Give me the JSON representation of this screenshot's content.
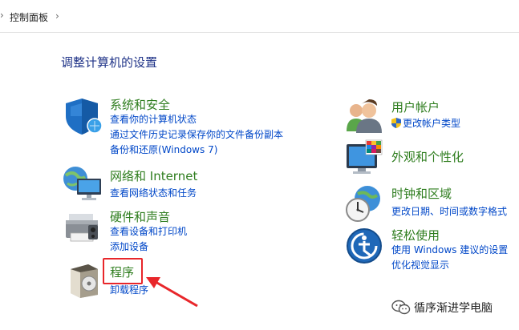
{
  "breadcrumb": {
    "label": "控制面板"
  },
  "page_title": "调整计算机的设置",
  "left_categories": [
    {
      "title": "系统和安全",
      "links": [
        "查看你的计算机状态",
        "通过文件历史记录保存你的文件备份副本",
        "备份和还原(Windows 7)"
      ]
    },
    {
      "title": "网络和 Internet",
      "links": [
        "查看网络状态和任务"
      ]
    },
    {
      "title": "硬件和声音",
      "links": [
        "查看设备和打印机",
        "添加设备"
      ]
    },
    {
      "title": "程序",
      "links": [
        "卸载程序"
      ]
    }
  ],
  "right_categories": [
    {
      "title": "用户帐户",
      "links": [
        "更改帐户类型"
      ]
    },
    {
      "title": "外观和个性化",
      "links": []
    },
    {
      "title": "时钟和区域",
      "links": [
        "更改日期、时间或数字格式"
      ]
    },
    {
      "title": "轻松使用",
      "links": [
        "使用 Windows 建议的设置",
        "优化视觉显示"
      ]
    }
  ],
  "watermark": {
    "text": "循序渐进学电脑"
  },
  "colors": {
    "title_green": "#2e7d1e",
    "link_blue": "#0047c8",
    "heading_blue": "#1e3287",
    "highlight_red": "#e8262a"
  },
  "icons": [
    "security-shield-icon",
    "network-globe-icon",
    "printer-icon",
    "program-box-icon",
    "users-icon",
    "display-palette-icon",
    "clock-globe-icon",
    "ease-of-access-icon",
    "wechat-icon"
  ]
}
